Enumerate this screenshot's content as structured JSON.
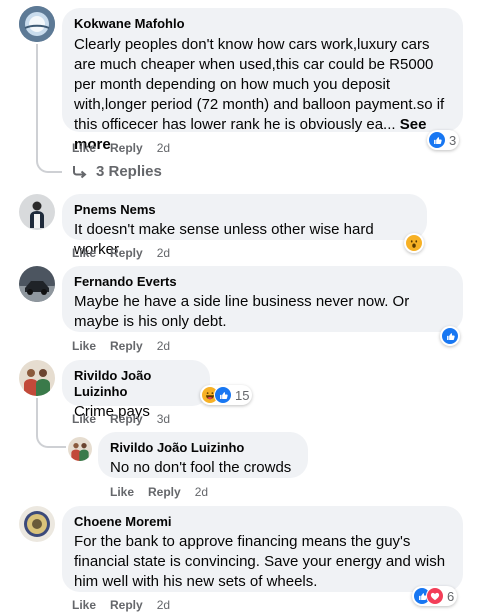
{
  "comments": [
    {
      "name": "Kokwane Mafohlo",
      "text": "Clearly peoples don't know how cars work,luxury cars are much cheaper when used,this car could be R5000 per month depending on how much you deposit with,longer period (72 month) and balloon payment.so if this officecer has lower rank he is obviously ea...",
      "see_more": "See more",
      "like": "Like",
      "reply": "Reply",
      "time": "2d",
      "reaction_count": "3",
      "replies_label": "3 Replies"
    },
    {
      "name": "Pnems Nems",
      "text": "It doesn't make sense unless other wise hard worker",
      "like": "Like",
      "reply": "Reply",
      "time": "2d"
    },
    {
      "name": "Fernando Everts",
      "text": "Maybe he have a side line business never now. Or maybe is his only debt.",
      "like": "Like",
      "reply": "Reply",
      "time": "2d"
    },
    {
      "name": "Rivildo João Luizinho",
      "text": "Crime pays",
      "like": "Like",
      "reply": "Reply",
      "time": "3d",
      "reaction_count": "15"
    },
    {
      "name": "Rivildo João Luizinho",
      "text": "No no don't fool the crowds",
      "like": "Like",
      "reply": "Reply",
      "time": "2d"
    },
    {
      "name": "Choene Moremi",
      "text": "For the bank to approve financing means the guy's financial state is convincing. Save your energy and wish him well with his new sets of wheels.",
      "like": "Like",
      "reply": "Reply",
      "time": "2d",
      "reaction_count": "6"
    }
  ],
  "icons": {
    "like": "thumbs-up-icon",
    "haha": "laughing-face-icon",
    "wow": "surprised-face-icon",
    "love": "heart-icon",
    "reply_arrow": "reply-arrow-icon"
  },
  "colors": {
    "bubble": "#f0f2f5",
    "action_text": "#65676b",
    "like_blue": "#1877f2",
    "love_red": "#f33e58",
    "emoji_yellow": "#f7b125"
  }
}
